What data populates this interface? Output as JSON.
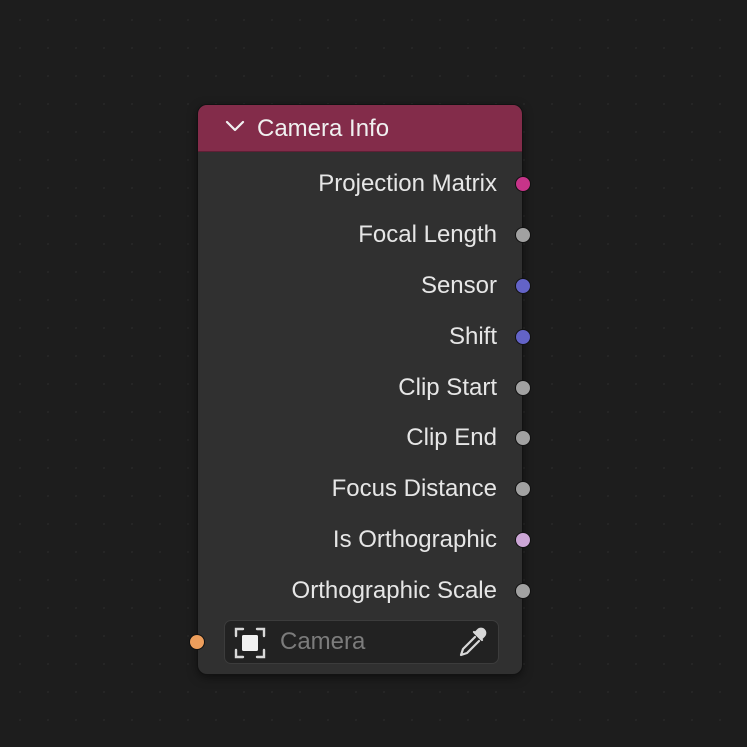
{
  "node": {
    "title": "Camera Info",
    "header_color": "#832c4a",
    "collapse_icon": "chevron-down-icon",
    "outputs": [
      {
        "label": "Projection Matrix",
        "socket_color": "#c73489"
      },
      {
        "label": "Focal Length",
        "socket_color": "#a1a1a1"
      },
      {
        "label": "Sensor",
        "socket_color": "#6363c7"
      },
      {
        "label": "Shift",
        "socket_color": "#6363c7"
      },
      {
        "label": "Clip Start",
        "socket_color": "#a1a1a1"
      },
      {
        "label": "Clip End",
        "socket_color": "#a1a1a1"
      },
      {
        "label": "Focus Distance",
        "socket_color": "#a1a1a1"
      },
      {
        "label": "Is Orthographic",
        "socket_color": "#cca6d6"
      },
      {
        "label": "Orthographic Scale",
        "socket_color": "#a1a1a1"
      }
    ],
    "input": {
      "placeholder": "Camera",
      "socket_color": "#ed9e5c",
      "object_icon": "object-data-icon",
      "picker_icon": "eyedropper-icon"
    }
  }
}
